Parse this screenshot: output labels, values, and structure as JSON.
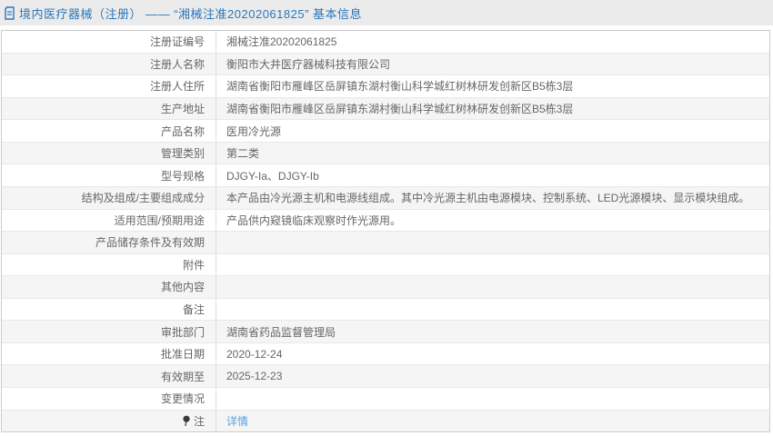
{
  "page": {
    "title": "境内医疗器械（注册） —— “湘械注准20202061825” 基本信息"
  },
  "icons": {
    "document_icon": "document-icon",
    "pin_icon": "pin-icon"
  },
  "colors": {
    "header_bg": "#ebebeb",
    "title_blue": "#2b76b9",
    "row_alt_bg": "#f5f5f5",
    "table_border": "#cccccc",
    "text_gray": "#666666",
    "link_blue": "#5e9ede"
  },
  "table": {
    "rows": [
      {
        "label": "注册证编号",
        "value": "湘械注准20202061825"
      },
      {
        "label": "注册人名称",
        "value": "衡阳市大井医疗器械科技有限公司"
      },
      {
        "label": "注册人住所",
        "value": "湖南省衡阳市雁峰区岳屏镇东湖村衡山科学城红树林研发创新区B5栋3层"
      },
      {
        "label": "生产地址",
        "value": "湖南省衡阳市雁峰区岳屏镇东湖村衡山科学城红树林研发创新区B5栋3层"
      },
      {
        "label": "产品名称",
        "value": "医用冷光源"
      },
      {
        "label": "管理类别",
        "value": "第二类"
      },
      {
        "label": "型号规格",
        "value": "DJGY-Ia、DJGY-Ib"
      },
      {
        "label": "结构及组成/主要组成成分",
        "value": "本产品由冷光源主机和电源线组成。其中冷光源主机由电源模块、控制系统、LED光源模块、显示模块组成。"
      },
      {
        "label": "适用范围/预期用途",
        "value": "产品供内窥镜临床观察时作光源用。"
      },
      {
        "label": "产品储存条件及有效期",
        "value": ""
      },
      {
        "label": "附件",
        "value": ""
      },
      {
        "label": "其他内容",
        "value": ""
      },
      {
        "label": "备注",
        "value": ""
      },
      {
        "label": "审批部门",
        "value": "湖南省药品监督管理局"
      },
      {
        "label": "批准日期",
        "value": "2020-12-24"
      },
      {
        "label": "有效期至",
        "value": "2025-12-23"
      },
      {
        "label": "变更情况",
        "value": ""
      },
      {
        "label": "注",
        "value": "详情"
      }
    ]
  }
}
